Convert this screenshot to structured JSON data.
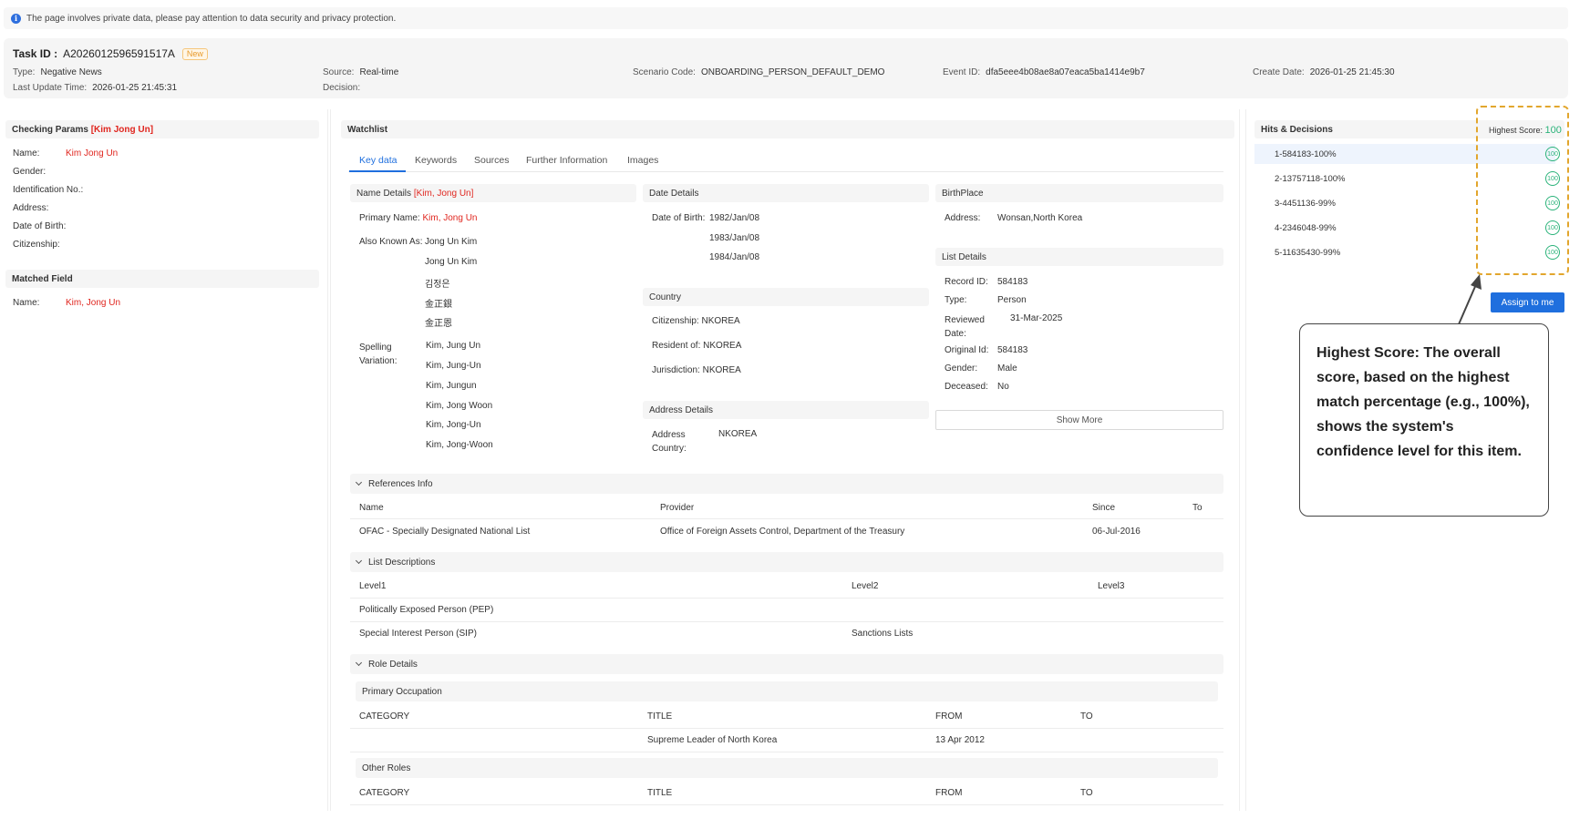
{
  "notice": "The page involves private data, please pay attention to data security and privacy protection.",
  "header": {
    "task_id_label": "Task ID :",
    "task_id": "A2026012596591517A",
    "badge": "New",
    "type_label": "Type:",
    "type": "Negative News",
    "source_label": "Source:",
    "source": "Real-time",
    "scenario_label": "Scenario Code:",
    "scenario": "ONBOARDING_PERSON_DEFAULT_DEMO",
    "event_label": "Event ID:",
    "event": "dfa5eee4b08ae8a07eaca5ba1414e9b7",
    "create_label": "Create Date:",
    "create": "2026-01-25 21:45:30",
    "update_label": "Last Update Time:",
    "update": "2026-01-25 21:45:31",
    "decision_label": "Decision:"
  },
  "checking": {
    "title": "Checking Params",
    "title_name": "[Kim Jong Un]",
    "name_label": "Name:",
    "name": "Kim Jong Un",
    "gender_label": "Gender:",
    "id_label": "Identification No.:",
    "address_label": "Address:",
    "dob_label": "Date of Birth:",
    "citizenship_label": "Citizenship:"
  },
  "matched": {
    "title": "Matched Field",
    "name_label": "Name:",
    "name": "Kim, Jong Un"
  },
  "watchlist": {
    "title": "Watchlist",
    "tabs": [
      "Key data",
      "Keywords",
      "Sources",
      "Further Information",
      "Images"
    ]
  },
  "name_details": {
    "title": "Name Details",
    "title_name": "[Kim, Jong Un]",
    "primary_label": "Primary Name:",
    "primary": "Kim, Jong Un",
    "aka_label": "Also Known As:",
    "aka": [
      "Jong Un Kim",
      "Jong Un Kim",
      "김정은",
      "金正銀",
      "金正恩"
    ],
    "spelling_label": "Spelling Variation:",
    "spelling": [
      "Kim, Jung Un",
      "Kim, Jung-Un",
      "Kim, Jungun",
      "Kim, Jong Woon",
      "Kim, Jong-Un",
      "Kim, Jong-Woon"
    ]
  },
  "date_details": {
    "title": "Date Details",
    "dob_label": "Date of Birth:",
    "dobs": [
      "1982/Jan/08",
      "1983/Jan/08",
      "1984/Jan/08"
    ]
  },
  "country": {
    "title": "Country",
    "citizenship_label": "Citizenship:",
    "citizenship": "NKOREA",
    "resident_label": "Resident of:",
    "resident": "NKOREA",
    "jurisdiction_label": "Jurisdiction:",
    "jurisdiction": "NKOREA"
  },
  "address_details": {
    "title": "Address Details",
    "label": "Address Country:",
    "value": "NKOREA"
  },
  "birthplace": {
    "title": "BirthPlace",
    "address_label": "Address:",
    "address": "Wonsan,North Korea"
  },
  "list_details": {
    "title": "List Details",
    "record_label": "Record ID:",
    "record": "584183",
    "type_label": "Type:",
    "type": "Person",
    "reviewed_label": "Reviewed Date:",
    "reviewed": "31-Mar-2025",
    "original_label": "Original Id:",
    "original": "584183",
    "gender_label": "Gender:",
    "gender": "Male",
    "deceased_label": "Deceased:",
    "deceased": "No",
    "show_more": "Show More"
  },
  "references": {
    "title": "References Info",
    "cols": [
      "Name",
      "Provider",
      "Since",
      "To"
    ],
    "row": [
      "OFAC - Specially Designated National List",
      "Office of Foreign Assets Control, Department of the Treasury",
      "06-Jul-2016",
      ""
    ]
  },
  "list_desc": {
    "title": "List Descriptions",
    "cols": [
      "Level1",
      "Level2",
      "Level3"
    ],
    "row1": "Politically Exposed Person (PEP)",
    "row2_l1": "Special Interest Person (SIP)",
    "row2_l2": "Sanctions Lists"
  },
  "role_details": {
    "title": "Role Details",
    "primary_title": "Primary Occupation",
    "cols": [
      "CATEGORY",
      "TITLE",
      "FROM",
      "TO"
    ],
    "primary_row_title": "Supreme Leader of North Korea",
    "primary_row_from": "13 Apr 2012",
    "other_title": "Other Roles"
  },
  "hits": {
    "title": "Hits & Decisions",
    "highest_label": "Highest Score:",
    "highest": "100",
    "items": [
      {
        "label": "1-584183-100%",
        "score": "100"
      },
      {
        "label": "2-13757118-100%",
        "score": "100"
      },
      {
        "label": "3-4451136-99%",
        "score": "100"
      },
      {
        "label": "4-2346048-99%",
        "score": "100"
      },
      {
        "label": "5-11635430-99%",
        "score": "100"
      }
    ],
    "assign": "Assign to me"
  },
  "callout": "Highest Score: The overall score, based on the highest match percentage (e.g., 100%), shows the system's confidence level for this item.",
  "colors": {
    "accent": "#1f6fde",
    "alert": "#e0261f",
    "score": "#2bb37a",
    "highlight": "#e2a62d"
  }
}
